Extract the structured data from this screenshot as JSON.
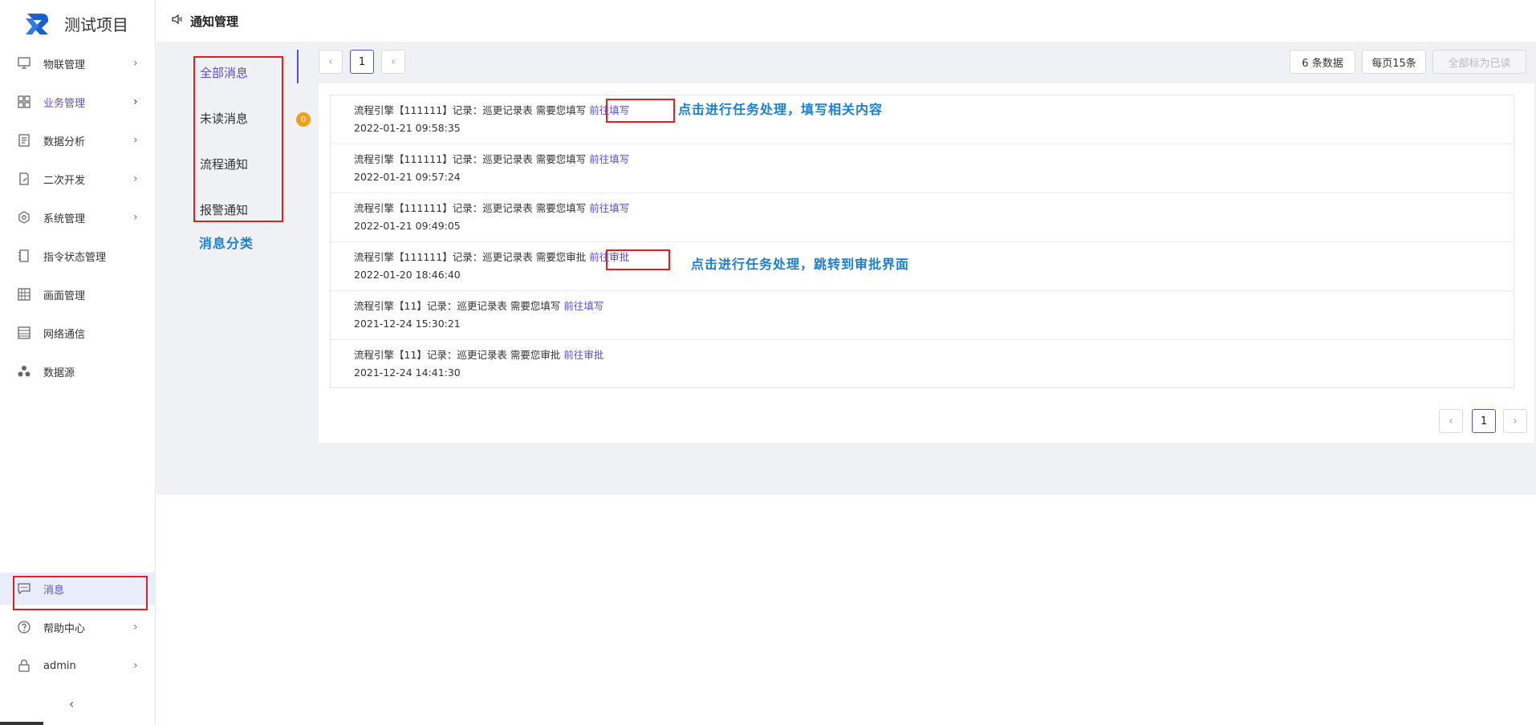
{
  "app": {
    "title": "测试项目"
  },
  "header": {
    "title": "通知管理"
  },
  "sidebar": {
    "items": [
      {
        "label": "物联管理",
        "icon": "monitor-icon",
        "chevron": "›"
      },
      {
        "label": "业务管理",
        "icon": "grid-icon",
        "chevron": "›"
      },
      {
        "label": "数据分析",
        "icon": "report-icon",
        "chevron": "›"
      },
      {
        "label": "二次开发",
        "icon": "edit-doc-icon",
        "chevron": "›"
      },
      {
        "label": "系统管理",
        "icon": "gear-icon",
        "chevron": "›"
      },
      {
        "label": "指令状态管理",
        "icon": "doc-icon"
      },
      {
        "label": "画面管理",
        "icon": "canvas-icon"
      },
      {
        "label": "网络通信",
        "icon": "list-icon"
      },
      {
        "label": "数据源",
        "icon": "cluster-icon"
      }
    ],
    "bottom_items": [
      {
        "label": "消息",
        "icon": "chat-icon"
      },
      {
        "label": "帮助中心",
        "icon": "help-icon",
        "chevron": "›"
      },
      {
        "label": "admin",
        "icon": "lock-icon",
        "chevron": "›"
      }
    ],
    "collapse": "‹"
  },
  "categories": {
    "items": [
      {
        "label": "全部消息"
      },
      {
        "label": "未读消息",
        "badge": "0"
      },
      {
        "label": "流程通知"
      },
      {
        "label": "报警通知"
      }
    ],
    "caption": "消息分类"
  },
  "pager": {
    "prev": "‹",
    "page": "1",
    "next": "›"
  },
  "toolbar": {
    "count": "6 条数据",
    "per_page": "每页15条",
    "mark_all": "全部标为已读"
  },
  "messages": [
    {
      "text": "流程引擎【111111】记录：巡更记录表 需要您填写",
      "link": "前往填写",
      "time": "2022-01-21 09:58:35"
    },
    {
      "text": "流程引擎【111111】记录：巡更记录表 需要您填写",
      "link": "前往填写",
      "time": "2022-01-21 09:57:24"
    },
    {
      "text": "流程引擎【111111】记录：巡更记录表 需要您填写",
      "link": "前往填写",
      "time": "2022-01-21 09:49:05"
    },
    {
      "text": "流程引擎【111111】记录：巡更记录表 需要您审批",
      "link": "前往审批",
      "time": "2022-01-20 18:46:40"
    },
    {
      "text": "流程引擎【11】记录：巡更记录表 需要您填写",
      "link": "前往填写",
      "time": "2021-12-24 15:30:21"
    },
    {
      "text": "流程引擎【11】记录：巡更记录表 需要您审批",
      "link": "前往审批",
      "time": "2021-12-24 14:41:30"
    }
  ],
  "annotations": {
    "fill_note": "点击进行任务处理，填写相关内容",
    "approve_note": "点击进行任务处理，跳转到审批界面"
  },
  "colors": {
    "accent": "#5b4ce0",
    "annotation_red": "#e02020",
    "annotation_blue": "#1a7fd6",
    "badge": "#f0a020"
  }
}
